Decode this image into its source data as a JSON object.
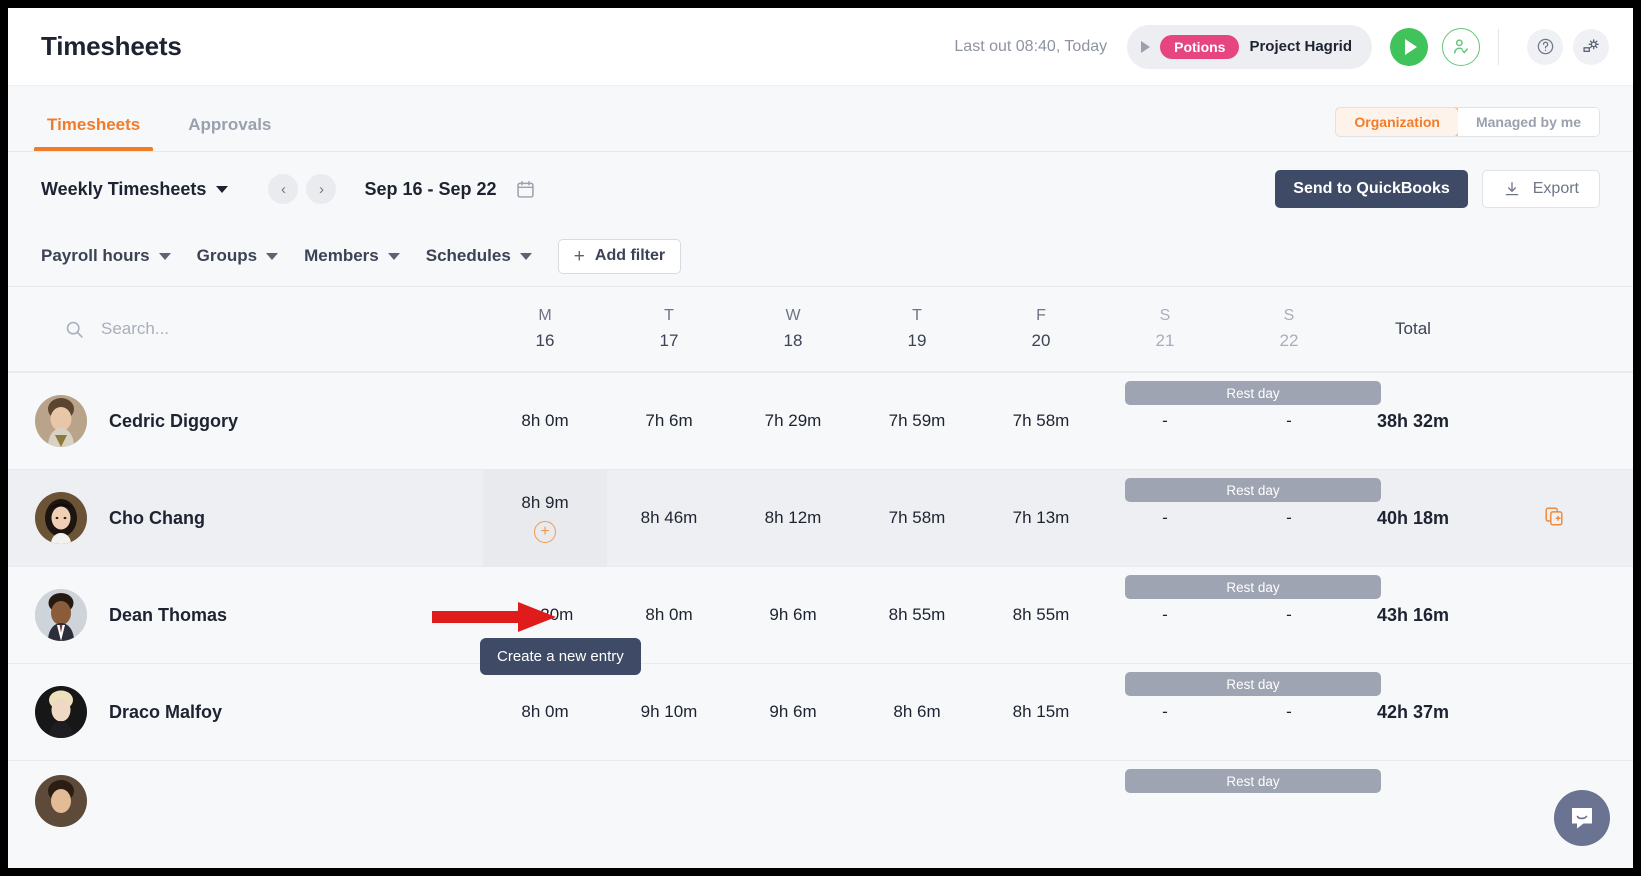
{
  "header": {
    "title": "Timesheets",
    "last_out": "Last out 08:40, Today",
    "timer": {
      "tag": "Potions",
      "project": "Project Hagrid"
    },
    "icons": {
      "play": "play-icon",
      "person_check": "person-check-icon",
      "help": "help-circle-icon",
      "settings": "settings-gear-icon"
    }
  },
  "tabs": [
    {
      "label": "Timesheets",
      "active": true
    },
    {
      "label": "Approvals",
      "active": false
    }
  ],
  "scope_toggle": {
    "options": [
      {
        "label": "Organization",
        "active": true
      },
      {
        "label": "Managed by me",
        "active": false
      }
    ]
  },
  "toolbar": {
    "view_select": "Weekly Timesheets",
    "prev_label": "‹",
    "next_label": "›",
    "date_range": "Sep 16 - Sep 22",
    "calendar_icon": "calendar-icon",
    "send_quickbooks": "Send to QuickBooks",
    "export": "Export"
  },
  "filters": {
    "items": [
      "Payroll hours",
      "Groups",
      "Members",
      "Schedules"
    ],
    "add_filter": "Add filter"
  },
  "search": {
    "placeholder": "Search..."
  },
  "columns": {
    "days": [
      {
        "letter": "M",
        "num": "16",
        "weekend": false
      },
      {
        "letter": "T",
        "num": "17",
        "weekend": false
      },
      {
        "letter": "W",
        "num": "18",
        "weekend": false
      },
      {
        "letter": "T",
        "num": "19",
        "weekend": false
      },
      {
        "letter": "F",
        "num": "20",
        "weekend": false
      },
      {
        "letter": "S",
        "num": "21",
        "weekend": true
      },
      {
        "letter": "S",
        "num": "22",
        "weekend": true
      }
    ],
    "total": "Total"
  },
  "rest_day_label": "Rest day",
  "rows": [
    {
      "name": "Cedric Diggory",
      "values": [
        "8h 0m",
        "7h 6m",
        "7h 29m",
        "7h 59m",
        "7h 58m",
        "-",
        "-"
      ],
      "total": "38h 32m",
      "rest_day": true
    },
    {
      "name": "Cho Chang",
      "values": [
        "8h 9m",
        "8h 46m",
        "8h 12m",
        "7h 58m",
        "7h 13m",
        "-",
        "-"
      ],
      "total": "40h 18m",
      "rest_day": true,
      "highlighted": true,
      "add_entry_icon": "plus-circle-icon",
      "copy_icon": "duplicate-add-icon"
    },
    {
      "name": "Dean Thomas",
      "values": [
        "8h 20m",
        "8h 0m",
        "9h 6m",
        "8h 55m",
        "8h 55m",
        "-",
        "-"
      ],
      "total": "43h 16m",
      "rest_day": true
    },
    {
      "name": "Draco Malfoy",
      "values": [
        "8h 0m",
        "9h 10m",
        "9h 6m",
        "8h 6m",
        "8h 15m",
        "-",
        "-"
      ],
      "total": "42h 37m",
      "rest_day": true
    }
  ],
  "tooltip": {
    "text": "Create a new entry"
  },
  "annotation": {
    "arrow": "red-arrow-pointing-right"
  },
  "chat_widget": {
    "icon": "chat-bubble-icon"
  },
  "colors": {
    "accent_orange": "#f07c2a",
    "tag_pink": "#e6457f",
    "play_green": "#3fc35a",
    "dark_navy": "#3e4a66",
    "rest_gray": "#9ea4b2"
  }
}
